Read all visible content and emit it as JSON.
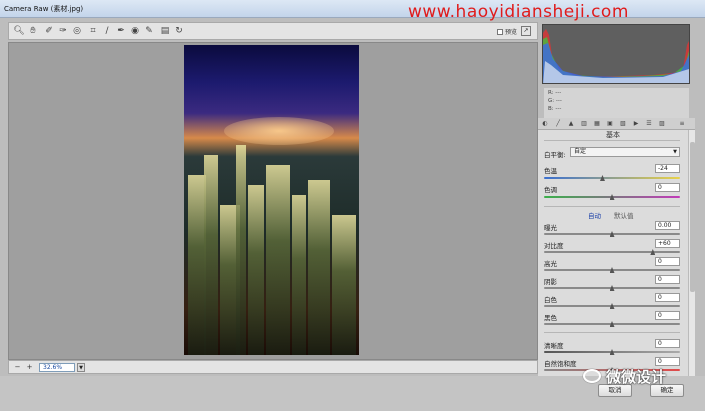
{
  "window": {
    "title": "Camera Raw (素材.jpg)"
  },
  "watermark": "www.haoyidiansheji.com",
  "toolbar": {
    "tools": [
      "zoom-icon",
      "hand-icon",
      "eyedropper-icon",
      "color-sampler-icon",
      "target-adjust-icon",
      "crop-icon",
      "straighten-icon",
      "spot-removal-icon",
      "red-eye-icon",
      "brush-icon",
      "gradient-icon",
      "rotate-icon"
    ],
    "preview_label": "预览"
  },
  "status": {
    "zoom_value": "32.6%"
  },
  "histogram": {
    "rgb": [
      "R: ---",
      "G: ---",
      "B: ---"
    ]
  },
  "panel": {
    "title": "基本",
    "white_balance": {
      "label": "白平衡:",
      "value": "自定"
    },
    "temperature": {
      "label": "色温",
      "value": "-24",
      "level": 0.43
    },
    "tint": {
      "label": "色调",
      "value": "0",
      "level": 0.5
    },
    "auto_link": "自动",
    "default_link": "默认值",
    "exposure": {
      "label": "曝光",
      "value": "0.00",
      "level": 0.5
    },
    "contrast": {
      "label": "对比度",
      "value": "+60",
      "level": 0.8
    },
    "highlights": {
      "label": "高光",
      "value": "0",
      "level": 0.5
    },
    "shadows": {
      "label": "阴影",
      "value": "0",
      "level": 0.5
    },
    "whites": {
      "label": "白色",
      "value": "0",
      "level": 0.5
    },
    "blacks": {
      "label": "黑色",
      "value": "0",
      "level": 0.5
    },
    "clarity": {
      "label": "清晰度",
      "value": "0",
      "level": 0.5
    },
    "vibrance": {
      "label": "自然饱和度",
      "value": "0",
      "level": 0.5
    }
  },
  "buttons": {
    "cancel": "取消",
    "ok": "确定"
  },
  "logo": {
    "text": "微微设计"
  }
}
